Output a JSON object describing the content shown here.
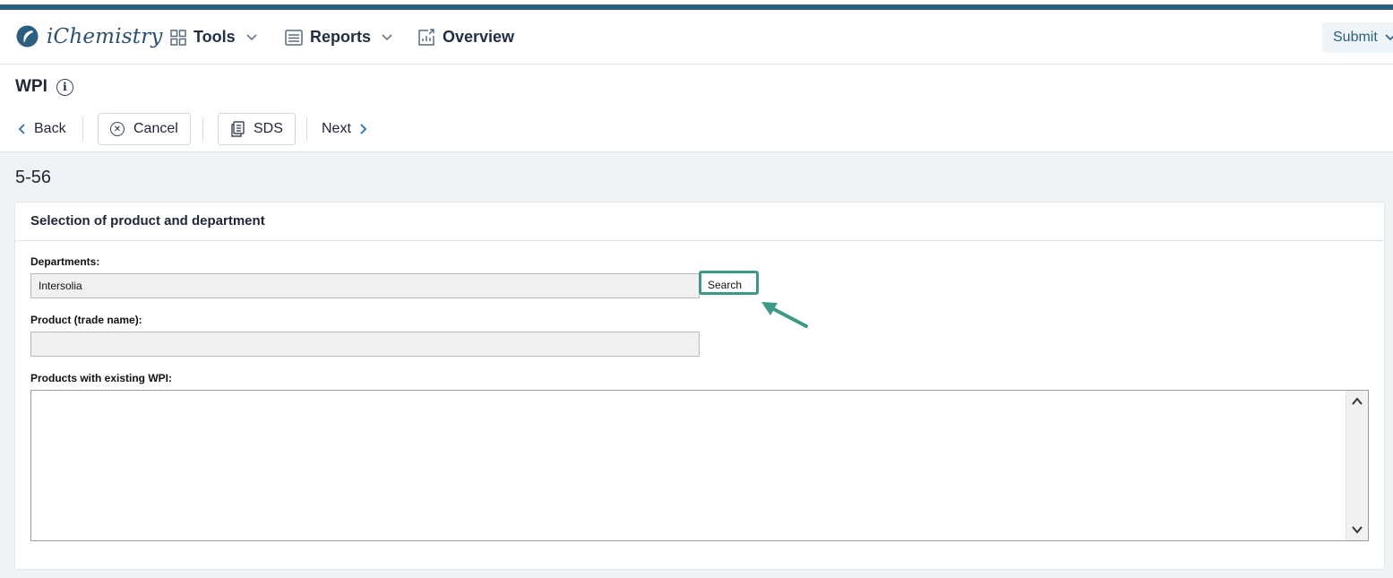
{
  "header": {
    "logo_text": "iChemistry",
    "nav": [
      {
        "label": "Tools",
        "icon": "grid-icon",
        "has_dropdown": true
      },
      {
        "label": "Reports",
        "icon": "list-icon",
        "has_dropdown": true
      },
      {
        "label": "Overview",
        "icon": "chart-icon",
        "has_dropdown": false
      }
    ],
    "submit_label": "Submit"
  },
  "page": {
    "title": "WPI",
    "actions": {
      "back": "Back",
      "cancel": "Cancel",
      "sds": "SDS",
      "next": "Next"
    },
    "record_id": "5-56"
  },
  "card": {
    "title": "Selection of product and department",
    "departments_label": "Departments:",
    "departments_value": "Intersolia",
    "search_label": "Search",
    "product_label": "Product (trade name):",
    "product_value": "",
    "existing_label": "Products with existing WPI:"
  },
  "colors": {
    "accent_bar": "#2c5f7e",
    "highlight": "#3a9a86",
    "link": "#2c6e9e"
  }
}
